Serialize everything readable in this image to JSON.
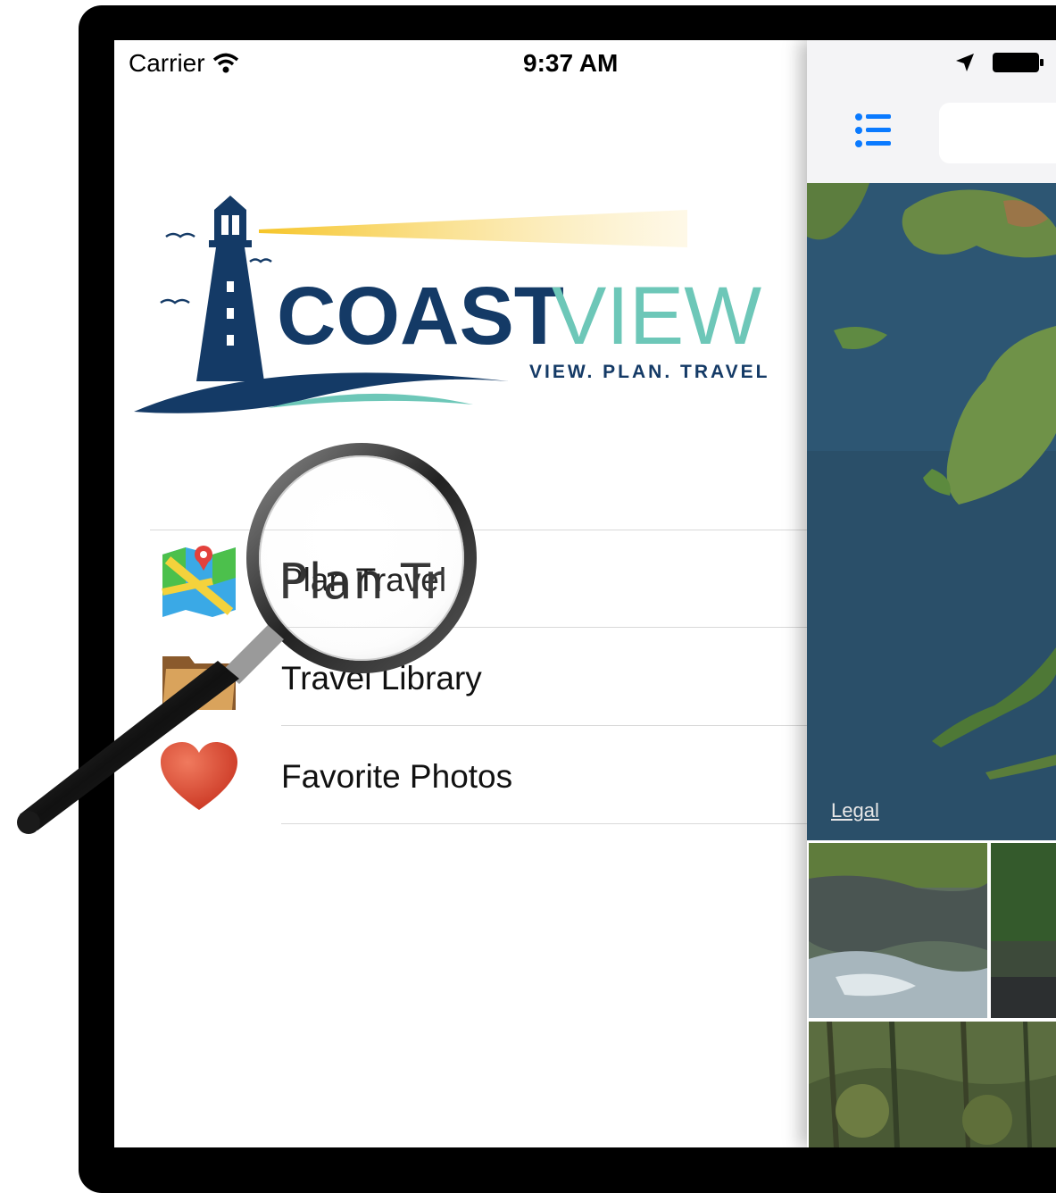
{
  "status_bar": {
    "carrier": "Carrier",
    "time": "9:37 AM"
  },
  "logo": {
    "name_part1": "COAST",
    "name_part2": "VIEW",
    "tagline": "VIEW. PLAN. TRAVEL"
  },
  "menu": {
    "items": [
      {
        "label": "Plan Travel",
        "icon": "map-icon"
      },
      {
        "label": "Travel Library",
        "icon": "folder-icon"
      },
      {
        "label": "Favorite Photos",
        "icon": "heart-icon"
      }
    ]
  },
  "magnifier": {
    "zoomed_text": "Plan Tr"
  },
  "side_panel": {
    "map_legal": "Legal"
  },
  "colors": {
    "accent_blue": "#0a7aff",
    "logo_navy": "#143a66",
    "logo_teal": "#6dc7b8",
    "heart_red": "#d9402b"
  }
}
